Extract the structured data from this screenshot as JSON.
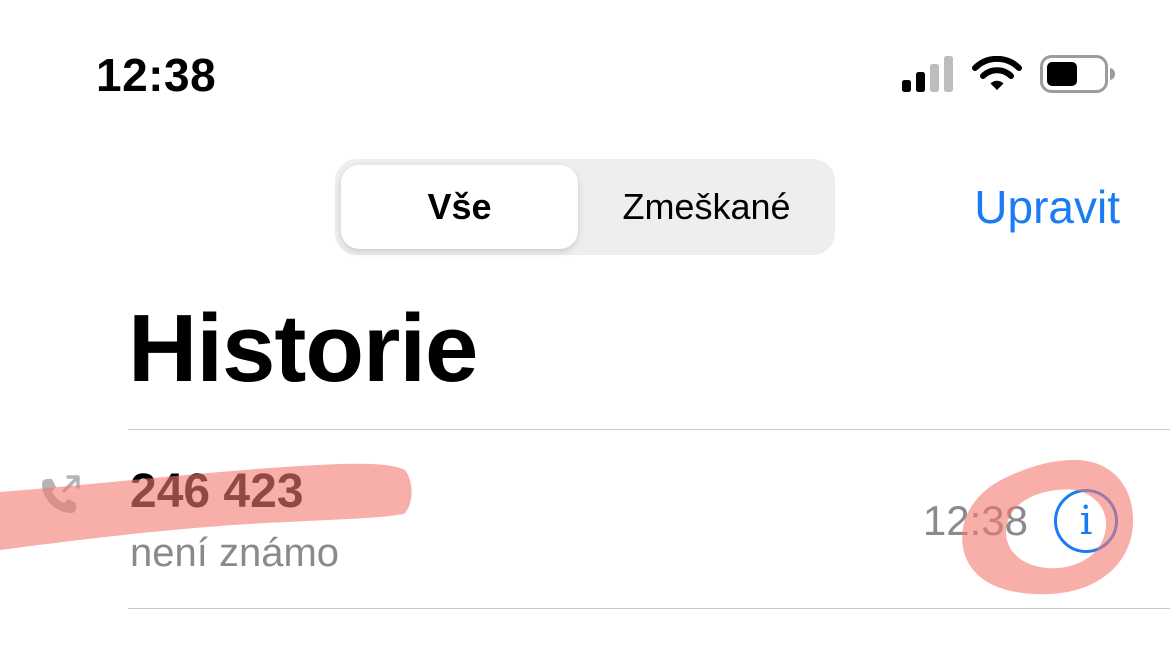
{
  "status_bar": {
    "time": "12:38",
    "signal_icon": "cellular-signal-icon",
    "wifi_icon": "wifi-icon",
    "battery_icon": "battery-icon"
  },
  "header": {
    "segments": [
      {
        "label": "Vše",
        "selected": true
      },
      {
        "label": "Zmeškané",
        "selected": false
      }
    ],
    "edit_label": "Upravit"
  },
  "page": {
    "title": "Historie"
  },
  "calls": [
    {
      "number": "246 423",
      "label": "není známo",
      "time": "12:38",
      "direction_icon": "outgoing-call-icon",
      "info_icon": "info-icon"
    }
  ],
  "colors": {
    "accent": "#1a7cf5",
    "secondary_text": "#8a8a8e",
    "redaction_marker": "#f47a70"
  }
}
